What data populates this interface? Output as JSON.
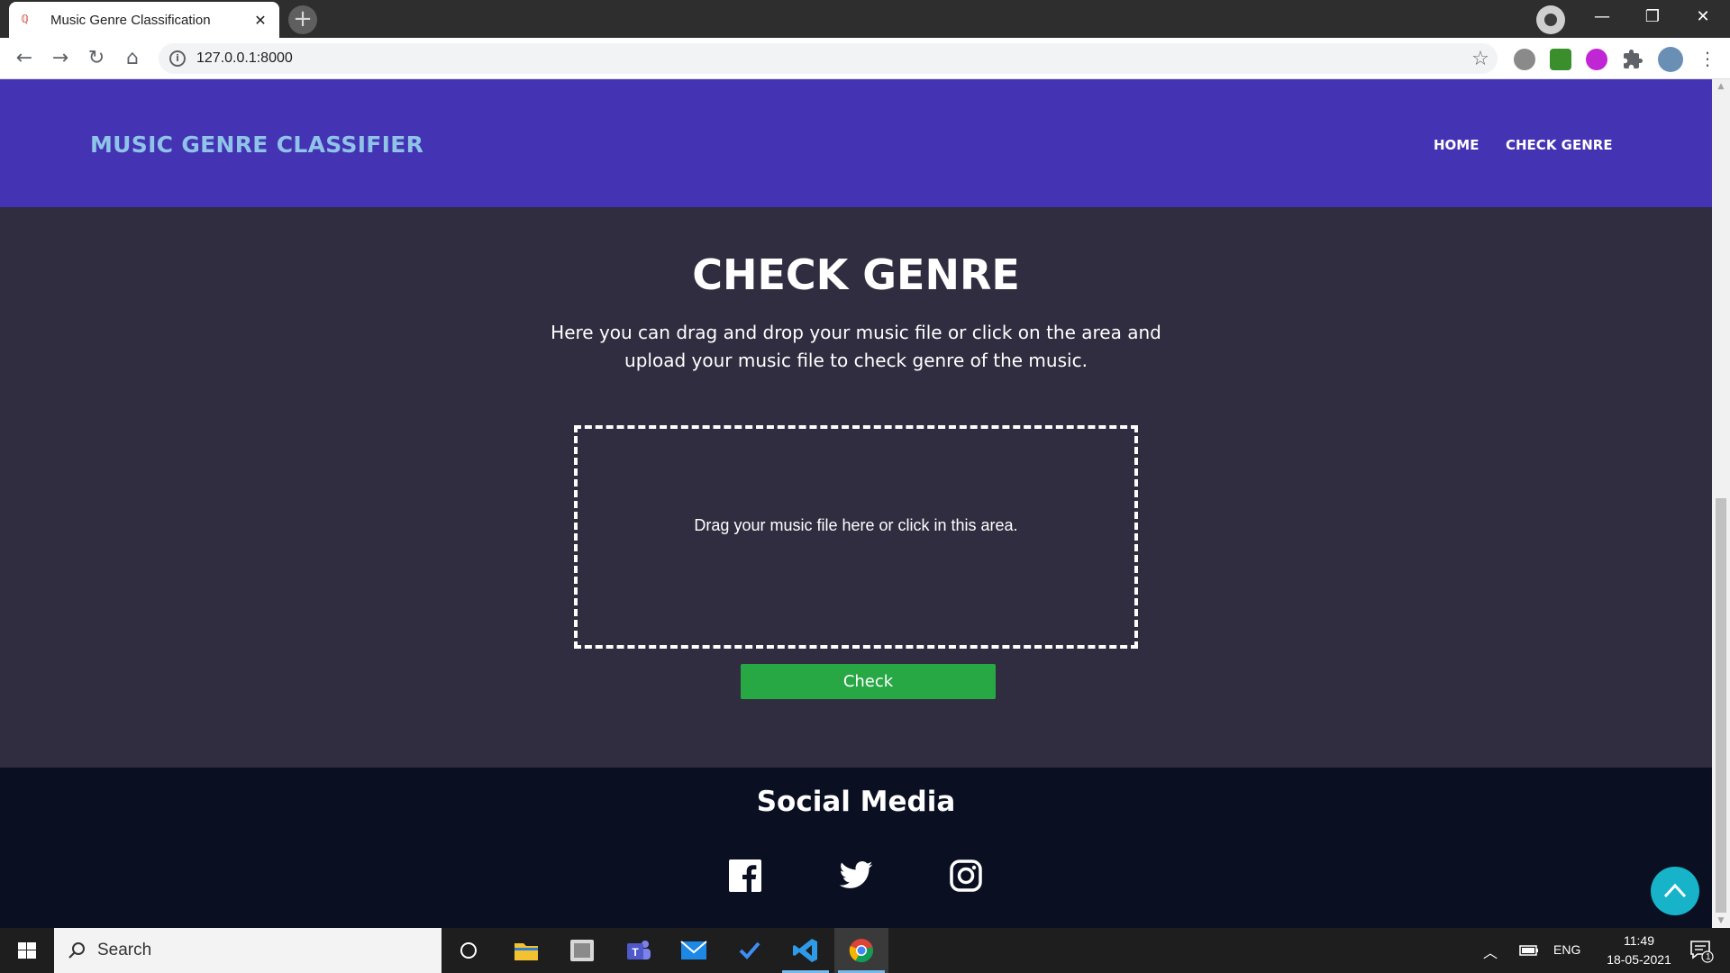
{
  "browser": {
    "tab_title": "Music Genre Classification",
    "tab_close": "✕",
    "new_tab": "+",
    "url": "127.0.0.1:8000",
    "window_controls": {
      "minimize": "—",
      "restore": "❐",
      "close": "✕"
    },
    "nav": {
      "back": "←",
      "forward": "→",
      "reload": "↻",
      "home": "⌂"
    },
    "star": "☆",
    "menu": "⋮"
  },
  "navbar": {
    "brand": "MUSIC GENRE CLASSIFIER",
    "links": [
      "HOME",
      "CHECK GENRE"
    ]
  },
  "main": {
    "title": "CHECK GENRE",
    "description": "Here you can drag and drop your music file or click on the area and upload your music file to check genre of the music.",
    "dropzone_text": "Drag your music file here or click in this area.",
    "check_button": "Check"
  },
  "footer": {
    "title": "Social Media",
    "icons": [
      "facebook-icon",
      "twitter-icon",
      "instagram-icon"
    ]
  },
  "taskbar": {
    "search_placeholder": "Search",
    "language": "ENG",
    "time": "11:49",
    "date": "18-05-2021",
    "notification_count": "1"
  },
  "colors": {
    "navbar_bg": "#4433b3",
    "brand": "#8fc3e8",
    "page_bg": "#302d40",
    "footer_bg": "#0a1021",
    "check_button": "#28a745",
    "back_to_top": "#17b3c9"
  }
}
